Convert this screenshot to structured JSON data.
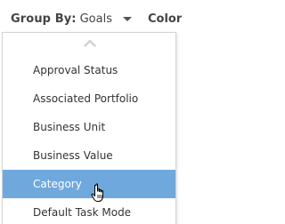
{
  "toolbar": {
    "group_by_label": "Group By:",
    "group_by_value": "Goals",
    "color_label": "Color"
  },
  "dropdown": {
    "items": [
      {
        "label": "Approval Status"
      },
      {
        "label": "Associated Portfolio"
      },
      {
        "label": "Business Unit"
      },
      {
        "label": "Business Value"
      },
      {
        "label": "Category"
      },
      {
        "label": "Default Task Mode"
      }
    ],
    "selected_index": 4
  },
  "colors": {
    "selected_bg": "#6fa8dc",
    "selected_text": "#ffffff",
    "text": "#333333",
    "border": "#d4d4d4"
  },
  "icons": {
    "dropdown_caret": "caret-down-icon",
    "scroll_up": "chevron-up-icon",
    "pointer": "hand-pointer-icon"
  }
}
